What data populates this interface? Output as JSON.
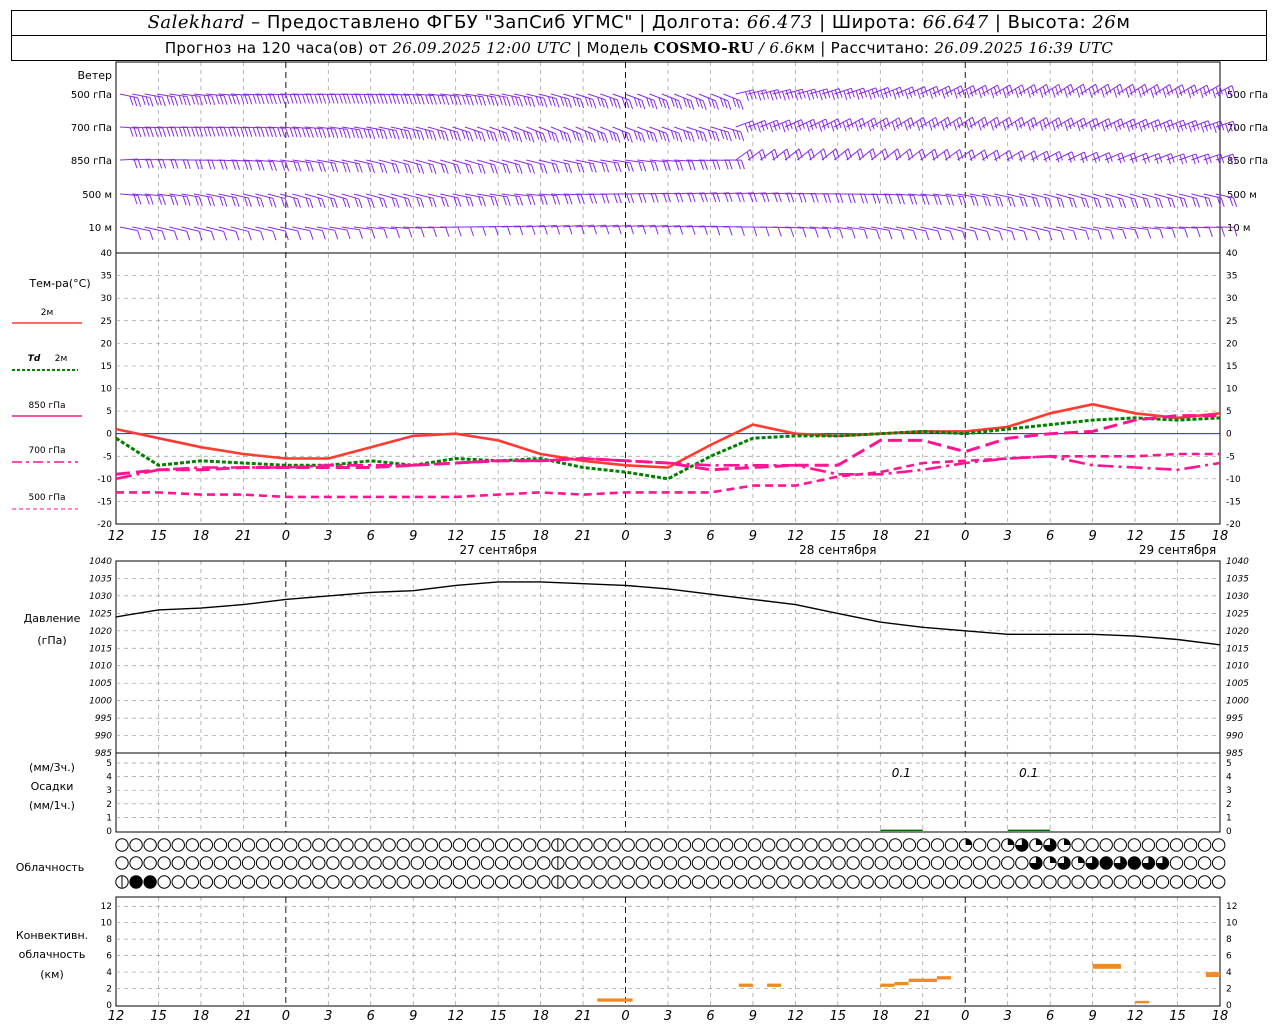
{
  "header": {
    "station": "Salekhard",
    "provided": "– Предоставлено ФГБУ \"ЗапСиб УГМС\" | Долгота:",
    "lon": "66.473",
    "lat_label": "| Широта:",
    "lat": "66.647",
    "alt_label": "| Высота:",
    "alt": "26",
    "alt_unit": "м",
    "forecast_prefix": "Прогноз на 120 часа(ов) от",
    "forecast_time": "26.09.2025 12:00 UTC",
    "model_label": "| Модель",
    "model": "COSMO-RU",
    "res_sep": "/",
    "res": "6.6",
    "res_unit": "км",
    "calc_label": "| Рассчитано:",
    "calc_time": "26.09.2025 16:39 UTC"
  },
  "labels": {
    "wind": "Ветер",
    "wind_levels": [
      "500 гПа",
      "700 гПа",
      "850 гПа",
      "500 м",
      "10 м"
    ],
    "temp_title": "Тем-ра(°C)",
    "temp_2m": "2м",
    "td_sym": "Td",
    "td_2m": "2м",
    "t850": "850 гПа",
    "t700": "700 гПа",
    "t500": "500 гПа",
    "pressure": "Давление",
    "pressure_unit": "(гПа)",
    "precip_3h": "(мм/3ч.)",
    "precip": "Осадки",
    "precip_1h": "(мм/1ч.)",
    "cloud": "Облачность",
    "conv1": "Конвективн.",
    "conv2": "облачность",
    "conv3": "(км)",
    "precip_ann": [
      "0.1",
      "0.1"
    ]
  },
  "colors": {
    "wind": "#8a2be2",
    "t2m": "#ff3b30",
    "td2m": "#008000",
    "tupper": "#ff1493",
    "pressure": "#000000",
    "precip": "#006400",
    "convective": "#f08a24",
    "zero_line": "#0000ff"
  },
  "chart_data": {
    "type": "line",
    "x_ticks": [
      "12",
      "15",
      "18",
      "21",
      "0",
      "3",
      "6",
      "9",
      "12",
      "15",
      "18",
      "21",
      "0",
      "3",
      "6",
      "9",
      "12",
      "15",
      "18",
      "21",
      "0",
      "3",
      "6",
      "9",
      "12",
      "15",
      "18"
    ],
    "date_labels": [
      "27 сентября",
      "28 сентября",
      "29 сентября"
    ],
    "hours": [
      0,
      3,
      6,
      9,
      12,
      15,
      18,
      21,
      24,
      27,
      30,
      33,
      36,
      39,
      42,
      45,
      48,
      51,
      54,
      57,
      60,
      63,
      66,
      69,
      72,
      75,
      78
    ],
    "temperature": {
      "ylim": [
        -20,
        40
      ],
      "yticks": [
        "40",
        "35",
        "30",
        "25",
        "20",
        "15",
        "10",
        "5",
        "0",
        "-5",
        "-10",
        "-15",
        "-20"
      ],
      "series": [
        {
          "name": "2м",
          "values": [
            1,
            -1,
            -3,
            -4.5,
            -5.5,
            -5.5,
            -3,
            -0.5,
            0,
            -1.5,
            -4.5,
            -6,
            -7,
            -7.5,
            -2.5,
            2,
            0,
            -0.5,
            0,
            0.5,
            0.5,
            1.5,
            4.5,
            6.5,
            4.5,
            3.5,
            4.5
          ]
        },
        {
          "name": "Td 2м",
          "values": [
            -1,
            -7,
            -6,
            -6.5,
            -7,
            -7,
            -6,
            -7,
            -5.5,
            -6,
            -5.5,
            -7.5,
            -8.5,
            -10,
            -5,
            -1,
            -0.5,
            -0.5,
            0,
            0.5,
            0,
            1,
            2,
            3,
            3.5,
            3,
            3.5
          ]
        },
        {
          "name": "850 гПа",
          "values": [
            -9,
            -8,
            -8,
            -7.5,
            -7.5,
            -7.5,
            -7.5,
            -7,
            -6.5,
            -6,
            -6,
            -5.5,
            -6,
            -6.5,
            -8,
            -7.5,
            -7,
            -7,
            -1.5,
            -1.5,
            -4,
            -1,
            0,
            0.5,
            3,
            4,
            4
          ]
        },
        {
          "name": "700 гПа",
          "values": [
            -10,
            -8,
            -7.5,
            -7.5,
            -7.5,
            -7,
            -7,
            -7,
            -6.5,
            -6,
            -6,
            -5.5,
            -6,
            -6.5,
            -7,
            -7,
            -7,
            -9,
            -9,
            -8,
            -6.5,
            -5.5,
            -5,
            -7,
            -7.5,
            -8,
            -6.5
          ]
        },
        {
          "name": "500 гПа",
          "values": [
            -13,
            -13,
            -13.5,
            -13.5,
            -14,
            -14,
            -14,
            -14,
            -14,
            -13.5,
            -13,
            -13.5,
            -13,
            -13,
            -13,
            -11.5,
            -11.5,
            -9.5,
            -8.5,
            -6.5,
            -6,
            -5.5,
            -5,
            -5,
            -5,
            -4.5,
            -4.5
          ]
        }
      ]
    },
    "pressure": {
      "ylim": [
        985,
        1040
      ],
      "yticks": [
        "1040",
        "1035",
        "1030",
        "1025",
        "1020",
        "1015",
        "1010",
        "1005",
        "1000",
        "995",
        "990",
        "985"
      ],
      "values": [
        1024,
        1026,
        1026.5,
        1027.5,
        1029,
        1030,
        1031,
        1031.5,
        1033,
        1034,
        1034,
        1033.5,
        1033,
        1032,
        1030.5,
        1029,
        1027.5,
        1025,
        1022.5,
        1021,
        1020,
        1019,
        1019,
        1019,
        1018.5,
        1017.5,
        1016
      ]
    },
    "precip": {
      "ylim": [
        0,
        5
      ],
      "yticks": [
        "5",
        "4",
        "3",
        "2",
        "1",
        "0"
      ],
      "values": [
        0,
        0,
        0,
        0,
        0,
        0,
        0,
        0,
        0,
        0,
        0,
        0,
        0,
        0,
        0,
        0,
        0,
        0,
        0.1,
        0,
        0,
        0.1,
        0,
        0,
        0,
        0,
        0
      ]
    },
    "convective": {
      "ylim": [
        0,
        13
      ],
      "yticks": [
        "12",
        "10",
        "8",
        "6",
        "4",
        "2",
        "0"
      ],
      "segments": [
        {
          "from": 34.0,
          "to": 36.5,
          "base": 0.4,
          "top": 0.8
        },
        {
          "from": 44.0,
          "to": 45.0,
          "base": 2.2,
          "top": 2.6
        },
        {
          "from": 46.0,
          "to": 47.0,
          "base": 2.2,
          "top": 2.6
        },
        {
          "from": 54.0,
          "to": 55.0,
          "base": 2.2,
          "top": 2.6
        },
        {
          "from": 55.0,
          "to": 56.0,
          "base": 2.4,
          "top": 2.8
        },
        {
          "from": 56.0,
          "to": 58.0,
          "base": 2.8,
          "top": 3.2
        },
        {
          "from": 58.0,
          "to": 59.0,
          "base": 3.1,
          "top": 3.5
        },
        {
          "from": 69.0,
          "to": 71.0,
          "base": 4.4,
          "top": 5.0
        },
        {
          "from": 72.0,
          "to": 73.0,
          "base": 0.2,
          "top": 0.5
        },
        {
          "from": 77.0,
          "to": 78.0,
          "base": 3.4,
          "top": 4.0
        }
      ]
    },
    "cloud_rows": {
      "rows": [
        "000000000000000000000000000000010000000000000000000000000000200232320000000000000000000024023232323232323323333323200001000000000000000000000000000000000000000000000000000000000000000000000000000000000000000000000000000000001443444",
        "000000000000000000000000000000010000000000000000000000000000000003232343433000000000442434344444444444443200000000000000000000000000000000000000000000000000000000000000000000000000000000000000000000000000000000000000000000002321444",
        "144000000000000000000000000000010000000000000000000000000000000000000000000000000000000041100000000000000000000000000000000000000000000000000000000000000000000000000000000000000000000000000000000000000000000000000000000000000000000000000000000"
      ]
    }
  }
}
